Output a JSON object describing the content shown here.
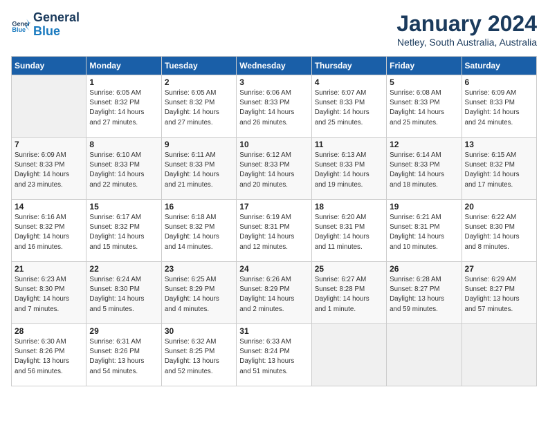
{
  "header": {
    "logo_line1": "General",
    "logo_line2": "Blue",
    "month": "January 2024",
    "location": "Netley, South Australia, Australia"
  },
  "days_of_week": [
    "Sunday",
    "Monday",
    "Tuesday",
    "Wednesday",
    "Thursday",
    "Friday",
    "Saturday"
  ],
  "weeks": [
    [
      {
        "day": "",
        "info": ""
      },
      {
        "day": "1",
        "info": "Sunrise: 6:05 AM\nSunset: 8:32 PM\nDaylight: 14 hours\nand 27 minutes."
      },
      {
        "day": "2",
        "info": "Sunrise: 6:05 AM\nSunset: 8:32 PM\nDaylight: 14 hours\nand 27 minutes."
      },
      {
        "day": "3",
        "info": "Sunrise: 6:06 AM\nSunset: 8:33 PM\nDaylight: 14 hours\nand 26 minutes."
      },
      {
        "day": "4",
        "info": "Sunrise: 6:07 AM\nSunset: 8:33 PM\nDaylight: 14 hours\nand 25 minutes."
      },
      {
        "day": "5",
        "info": "Sunrise: 6:08 AM\nSunset: 8:33 PM\nDaylight: 14 hours\nand 25 minutes."
      },
      {
        "day": "6",
        "info": "Sunrise: 6:09 AM\nSunset: 8:33 PM\nDaylight: 14 hours\nand 24 minutes."
      }
    ],
    [
      {
        "day": "7",
        "info": "Sunrise: 6:09 AM\nSunset: 8:33 PM\nDaylight: 14 hours\nand 23 minutes."
      },
      {
        "day": "8",
        "info": "Sunrise: 6:10 AM\nSunset: 8:33 PM\nDaylight: 14 hours\nand 22 minutes."
      },
      {
        "day": "9",
        "info": "Sunrise: 6:11 AM\nSunset: 8:33 PM\nDaylight: 14 hours\nand 21 minutes."
      },
      {
        "day": "10",
        "info": "Sunrise: 6:12 AM\nSunset: 8:33 PM\nDaylight: 14 hours\nand 20 minutes."
      },
      {
        "day": "11",
        "info": "Sunrise: 6:13 AM\nSunset: 8:33 PM\nDaylight: 14 hours\nand 19 minutes."
      },
      {
        "day": "12",
        "info": "Sunrise: 6:14 AM\nSunset: 8:33 PM\nDaylight: 14 hours\nand 18 minutes."
      },
      {
        "day": "13",
        "info": "Sunrise: 6:15 AM\nSunset: 8:32 PM\nDaylight: 14 hours\nand 17 minutes."
      }
    ],
    [
      {
        "day": "14",
        "info": "Sunrise: 6:16 AM\nSunset: 8:32 PM\nDaylight: 14 hours\nand 16 minutes."
      },
      {
        "day": "15",
        "info": "Sunrise: 6:17 AM\nSunset: 8:32 PM\nDaylight: 14 hours\nand 15 minutes."
      },
      {
        "day": "16",
        "info": "Sunrise: 6:18 AM\nSunset: 8:32 PM\nDaylight: 14 hours\nand 14 minutes."
      },
      {
        "day": "17",
        "info": "Sunrise: 6:19 AM\nSunset: 8:31 PM\nDaylight: 14 hours\nand 12 minutes."
      },
      {
        "day": "18",
        "info": "Sunrise: 6:20 AM\nSunset: 8:31 PM\nDaylight: 14 hours\nand 11 minutes."
      },
      {
        "day": "19",
        "info": "Sunrise: 6:21 AM\nSunset: 8:31 PM\nDaylight: 14 hours\nand 10 minutes."
      },
      {
        "day": "20",
        "info": "Sunrise: 6:22 AM\nSunset: 8:30 PM\nDaylight: 14 hours\nand 8 minutes."
      }
    ],
    [
      {
        "day": "21",
        "info": "Sunrise: 6:23 AM\nSunset: 8:30 PM\nDaylight: 14 hours\nand 7 minutes."
      },
      {
        "day": "22",
        "info": "Sunrise: 6:24 AM\nSunset: 8:30 PM\nDaylight: 14 hours\nand 5 minutes."
      },
      {
        "day": "23",
        "info": "Sunrise: 6:25 AM\nSunset: 8:29 PM\nDaylight: 14 hours\nand 4 minutes."
      },
      {
        "day": "24",
        "info": "Sunrise: 6:26 AM\nSunset: 8:29 PM\nDaylight: 14 hours\nand 2 minutes."
      },
      {
        "day": "25",
        "info": "Sunrise: 6:27 AM\nSunset: 8:28 PM\nDaylight: 14 hours\nand 1 minute."
      },
      {
        "day": "26",
        "info": "Sunrise: 6:28 AM\nSunset: 8:27 PM\nDaylight: 13 hours\nand 59 minutes."
      },
      {
        "day": "27",
        "info": "Sunrise: 6:29 AM\nSunset: 8:27 PM\nDaylight: 13 hours\nand 57 minutes."
      }
    ],
    [
      {
        "day": "28",
        "info": "Sunrise: 6:30 AM\nSunset: 8:26 PM\nDaylight: 13 hours\nand 56 minutes."
      },
      {
        "day": "29",
        "info": "Sunrise: 6:31 AM\nSunset: 8:26 PM\nDaylight: 13 hours\nand 54 minutes."
      },
      {
        "day": "30",
        "info": "Sunrise: 6:32 AM\nSunset: 8:25 PM\nDaylight: 13 hours\nand 52 minutes."
      },
      {
        "day": "31",
        "info": "Sunrise: 6:33 AM\nSunset: 8:24 PM\nDaylight: 13 hours\nand 51 minutes."
      },
      {
        "day": "",
        "info": ""
      },
      {
        "day": "",
        "info": ""
      },
      {
        "day": "",
        "info": ""
      }
    ]
  ]
}
